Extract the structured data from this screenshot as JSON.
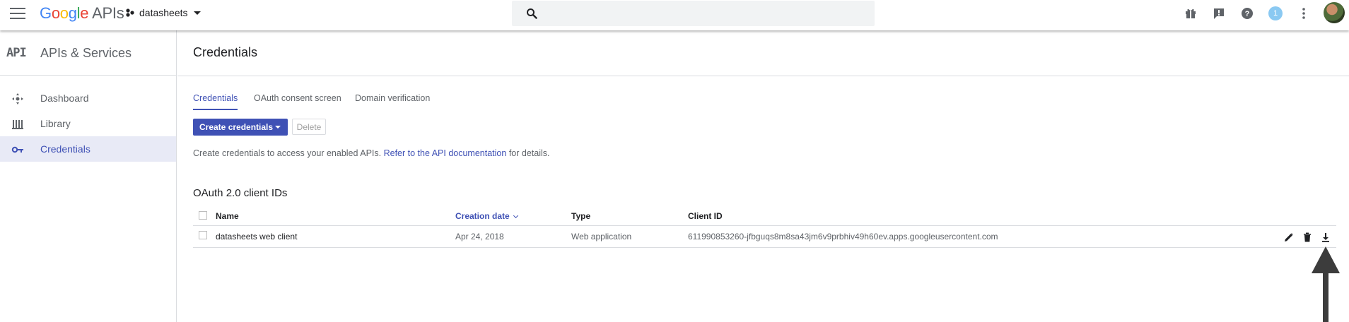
{
  "header": {
    "logo_google": [
      "G",
      "o",
      "o",
      "g",
      "l",
      "e"
    ],
    "logo_suffix": "APIs",
    "project_name": "datasheets",
    "notification_count": "1",
    "icons": [
      "menu-icon",
      "project-icon",
      "search-icon",
      "gift-icon",
      "feedback-icon",
      "help-icon",
      "more-vert-icon"
    ]
  },
  "sidebar": {
    "logo_text": "API",
    "title": "APIs & Services",
    "items": [
      {
        "label": "Dashboard",
        "icon": "dashboard-icon",
        "active": false
      },
      {
        "label": "Library",
        "icon": "library-icon",
        "active": false
      },
      {
        "label": "Credentials",
        "icon": "key-icon",
        "active": true
      }
    ]
  },
  "main": {
    "title": "Credentials",
    "tabs": [
      {
        "label": "Credentials",
        "active": true
      },
      {
        "label": "OAuth consent screen",
        "active": false
      },
      {
        "label": "Domain verification",
        "active": false
      }
    ],
    "create_button": "Create credentials",
    "delete_button": "Delete",
    "help_prefix": "Create credentials to access your enabled APIs.",
    "help_link": "Refer to the API documentation",
    "help_suffix": "for details.",
    "section_title": "OAuth 2.0 client IDs",
    "table": {
      "columns": [
        "Name",
        "Creation date",
        "Type",
        "Client ID"
      ],
      "rows": [
        {
          "name": "datasheets web client",
          "creation_date": "Apr 24, 2018",
          "type": "Web application",
          "client_id": "611990853260-jfbguqs8m8sa43jm6v9prbhiv49h60ev.apps.googleusercontent.com",
          "actions": [
            "edit-icon",
            "delete-icon",
            "download-icon"
          ]
        }
      ]
    }
  },
  "colors": {
    "accent": "#3f51b5",
    "active_nav_bg": "#e8eaf6",
    "annotation_arrow": "#3c3c3c"
  }
}
